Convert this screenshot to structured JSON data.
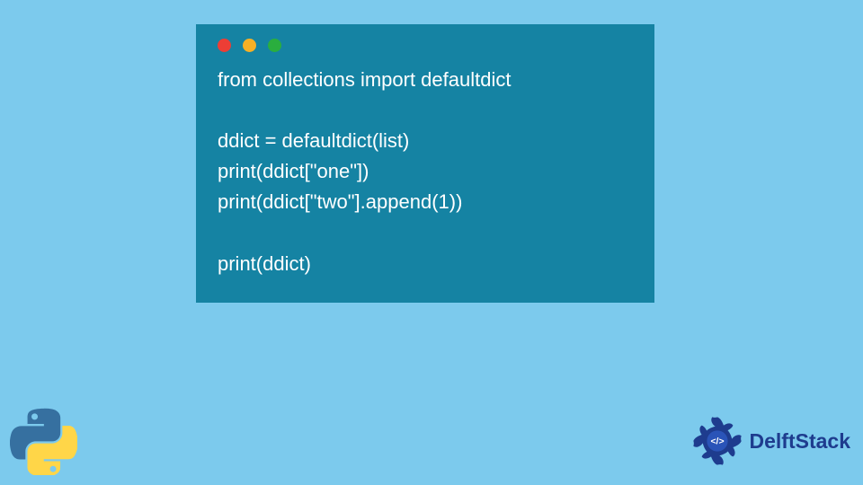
{
  "code": {
    "lines": [
      "from collections import defaultdict",
      "",
      "ddict = defaultdict(list)",
      "print(ddict[\"one\"])",
      "print(ddict[\"two\"].append(1))",
      "",
      "print(ddict)"
    ]
  },
  "brand": {
    "name": "DelftStack"
  },
  "traffic_light_colors": {
    "red": "#ec3e35",
    "yellow": "#f6b026",
    "green": "#2aae3e"
  }
}
